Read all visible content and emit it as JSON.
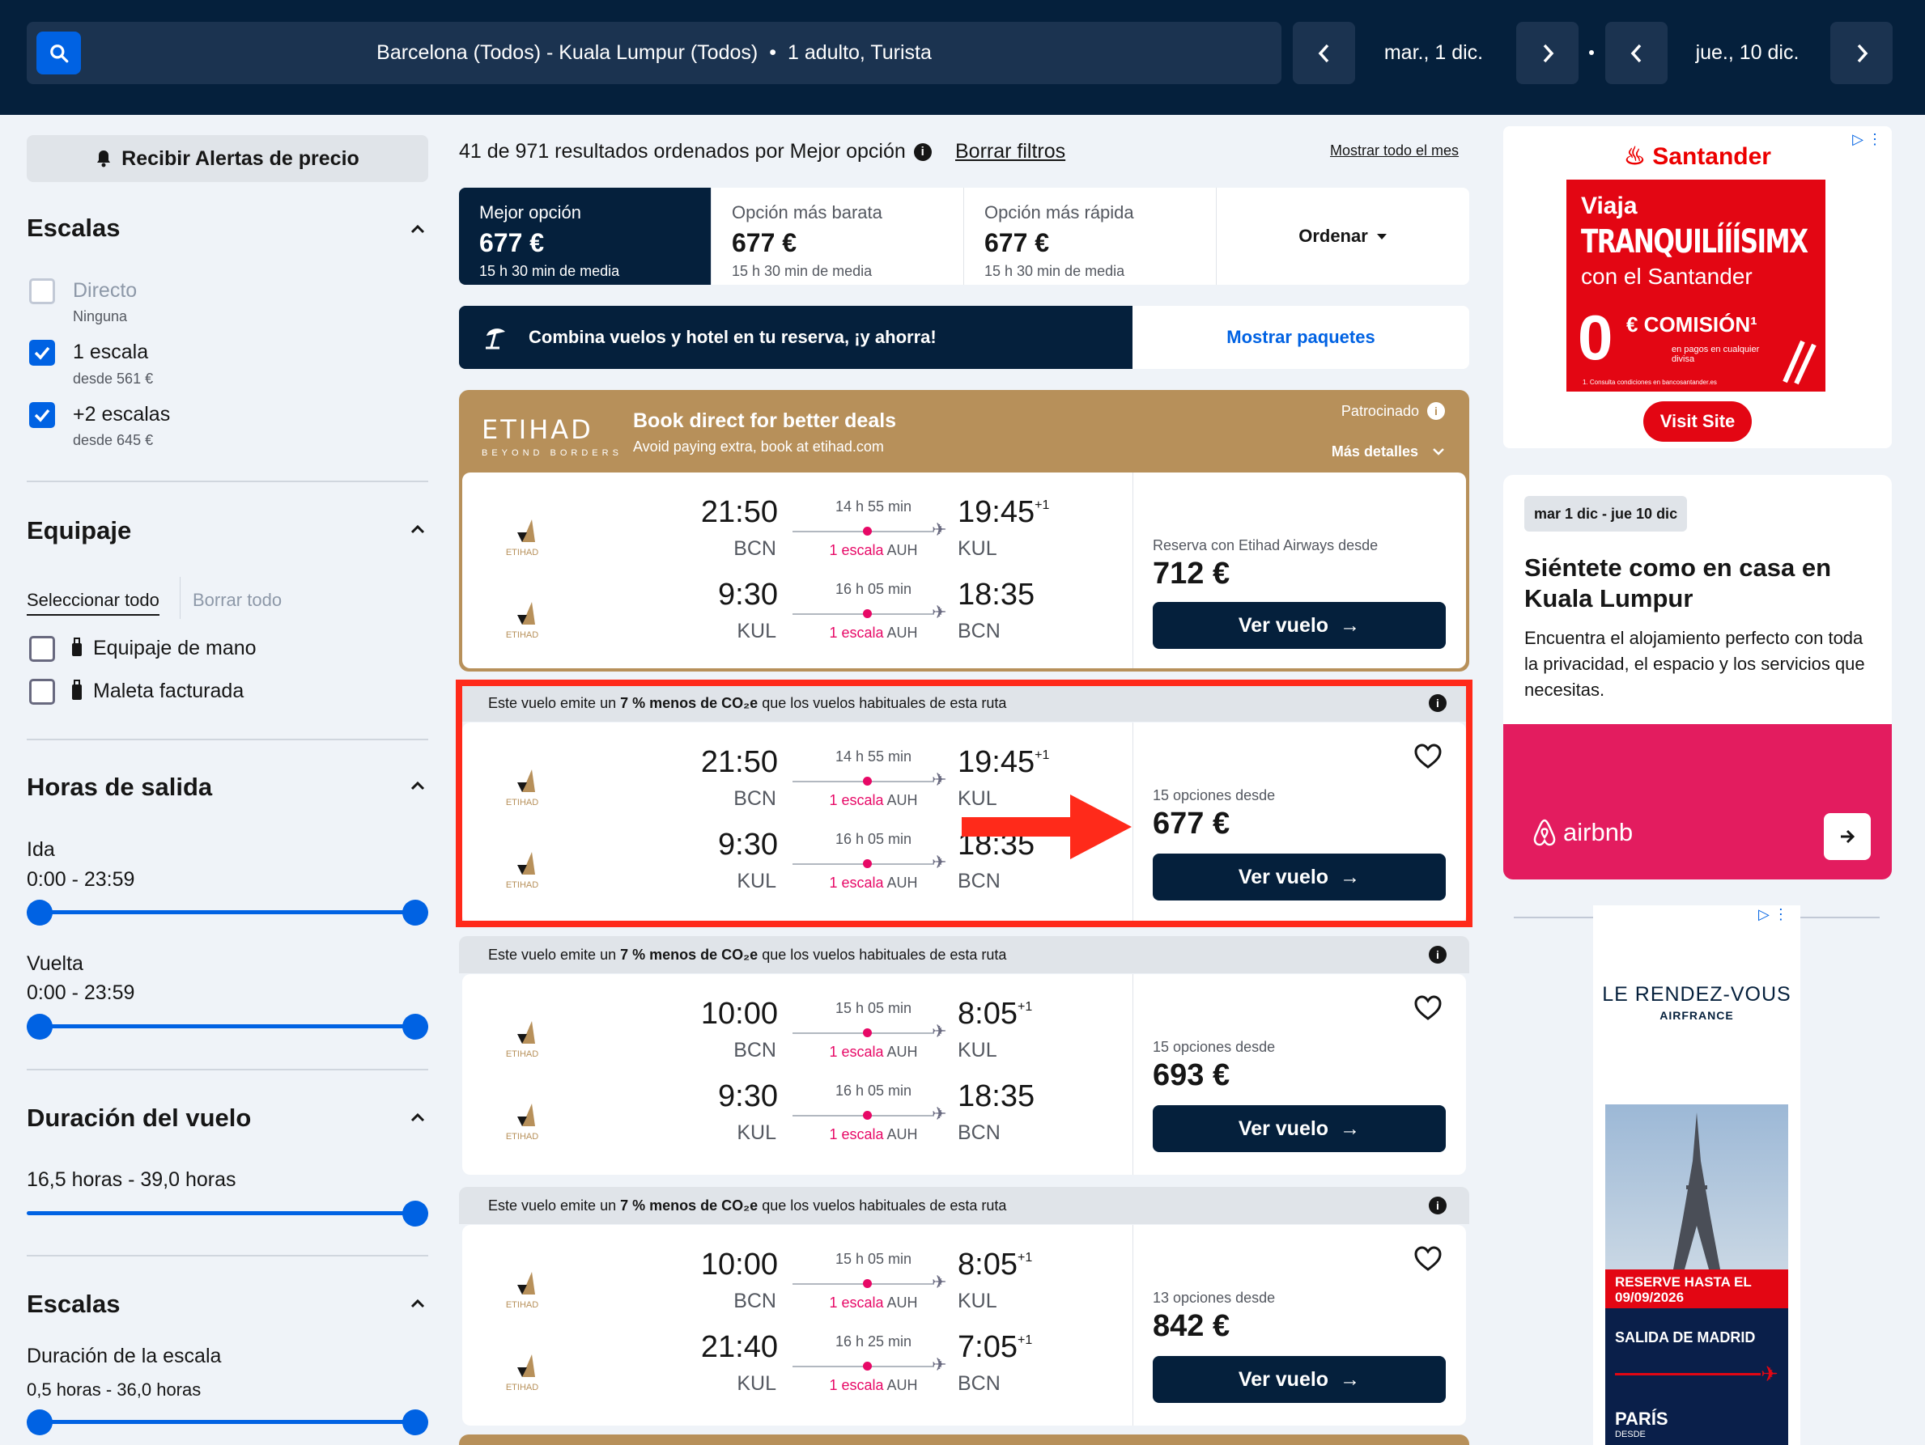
{
  "header": {
    "route": "Barcelona (Todos) - Kuala Lumpur (Todos)",
    "passengers": "1 adulto, Turista",
    "depart_date": "mar., 1 dic.",
    "return_date": "jue., 10 dic."
  },
  "sidebar": {
    "price_alert": "Recibir Alertas de precio",
    "stops": {
      "title": "Escalas",
      "options": [
        {
          "label": "Directo",
          "sub": "Ninguna",
          "checked": false
        },
        {
          "label": "1 escala",
          "sub": "desde 561 €",
          "checked": true
        },
        {
          "label": "+2 escalas",
          "sub": "desde 645 €",
          "checked": true
        }
      ]
    },
    "baggage": {
      "title": "Equipaje",
      "select_all": "Seleccionar todo",
      "clear_all": "Borrar todo",
      "options": [
        "Equipaje de mano",
        "Maleta facturada"
      ]
    },
    "departure_times": {
      "title": "Horas de salida",
      "outbound_label": "Ida",
      "outbound_range": "0:00 - 23:59",
      "return_label": "Vuelta",
      "return_range": "0:00 - 23:59"
    },
    "duration": {
      "title": "Duración del vuelo",
      "range": "16,5 horas - 39,0 horas"
    },
    "layovers": {
      "title": "Escalas",
      "subtitle": "Duración de la escala",
      "range": "0,5 horas - 36,0 horas"
    }
  },
  "results": {
    "summary": "41 de 971 resultados ordenados por Mejor opción",
    "clear_filters": "Borrar filtros",
    "show_month": "Mostrar todo el mes",
    "sort_tabs": [
      {
        "label": "Mejor opción",
        "price": "677 €",
        "avg": "15 h 30 min de media"
      },
      {
        "label": "Opción más barata",
        "price": "677 €",
        "avg": "15 h 30 min de media"
      },
      {
        "label": "Opción más rápida",
        "price": "677 €",
        "avg": "15 h 30 min de media"
      }
    ],
    "order_label": "Ordenar",
    "combo_text": "Combina vuelos y hotel en tu reserva, ¡y ahorra!",
    "combo_button": "Mostrar paquetes"
  },
  "sponsor": {
    "logo": "ETIHAD",
    "logo_tagline": "BEYOND BORDERS",
    "title": "Book direct for better deals",
    "subtitle": "Avoid paying extra, book at etihad.com",
    "sponsored": "Patrocinado",
    "more": "Más detalles",
    "book_with": "Reserva con Etihad Airways desde",
    "price": "712 €",
    "view": "Ver vuelo",
    "out": {
      "dep": "21:50",
      "dep_code": "BCN",
      "dur": "14 h 55 min",
      "stop": "1 escala",
      "via": "AUH",
      "arr": "19:45",
      "plus": "+1",
      "arr_code": "KUL"
    },
    "ret": {
      "dep": "9:30",
      "dep_code": "KUL",
      "dur": "16 h 05 min",
      "stop": "1 escala",
      "via": "AUH",
      "arr": "18:35",
      "plus": "",
      "arr_code": "BCN"
    }
  },
  "co2_notice": {
    "pre": "Este vuelo emite un ",
    "bold": "7 % menos de CO₂e",
    "post": " que los vuelos habituales de esta ruta"
  },
  "flights": [
    {
      "options": "15 opciones desde",
      "price": "677 €",
      "view": "Ver vuelo",
      "out": {
        "dep": "21:50",
        "dep_code": "BCN",
        "dur": "14 h 55 min",
        "stop": "1 escala",
        "via": "AUH",
        "arr": "19:45",
        "plus": "+1",
        "arr_code": "KUL"
      },
      "ret": {
        "dep": "9:30",
        "dep_code": "KUL",
        "dur": "16 h 05 min",
        "stop": "1 escala",
        "via": "AUH",
        "arr": "18:35",
        "plus": "",
        "arr_code": "BCN"
      }
    },
    {
      "options": "15 opciones desde",
      "price": "693 €",
      "view": "Ver vuelo",
      "out": {
        "dep": "10:00",
        "dep_code": "BCN",
        "dur": "15 h 05 min",
        "stop": "1 escala",
        "via": "AUH",
        "arr": "8:05",
        "plus": "+1",
        "arr_code": "KUL"
      },
      "ret": {
        "dep": "9:30",
        "dep_code": "KUL",
        "dur": "16 h 05 min",
        "stop": "1 escala",
        "via": "AUH",
        "arr": "18:35",
        "plus": "",
        "arr_code": "BCN"
      }
    },
    {
      "options": "13 opciones desde",
      "price": "842 €",
      "view": "Ver vuelo",
      "out": {
        "dep": "10:00",
        "dep_code": "BCN",
        "dur": "15 h 05 min",
        "stop": "1 escala",
        "via": "AUH",
        "arr": "8:05",
        "plus": "+1",
        "arr_code": "KUL"
      },
      "ret": {
        "dep": "21:40",
        "dep_code": "KUL",
        "dur": "16 h 25 min",
        "stop": "1 escala",
        "via": "AUH",
        "arr": "7:05",
        "plus": "+1",
        "arr_code": "BCN"
      }
    }
  ],
  "ads": {
    "santander": {
      "brand": "Santander",
      "line1": "Viaja",
      "line2": "TRANQUILÍÍÍSIMX",
      "line3": "con el Santander",
      "zero": "0",
      "commission": "€ COMISIÓN¹",
      "detail": "en pagos en cualquier divisa",
      "fine": "1. Consulta condiciones en bancosantander.es",
      "cta": "Visit Site"
    },
    "airbnb": {
      "dates": "mar 1 dic - jue 10 dic",
      "title": "Siéntete como en casa en Kuala Lumpur",
      "text": "Encuentra el alojamiento perfecto con toda la privacidad, el espacio y los servicios que necesitas.",
      "brand": "airbnb"
    },
    "airfrance": {
      "title": "LE RENDEZ-VOUS",
      "brand": "AIRFRANCE",
      "banner": "RESERVE HASTA EL 09/09/2026",
      "from": "SALIDA DE MADRID",
      "dest": "PARÍS",
      "small": "DESDE"
    }
  },
  "colors": {
    "navy": "#05203c",
    "blue": "#0062e3",
    "pink": "#e70866",
    "etihad_gold": "#b7905a",
    "highlight_red": "#ff2a1a"
  }
}
